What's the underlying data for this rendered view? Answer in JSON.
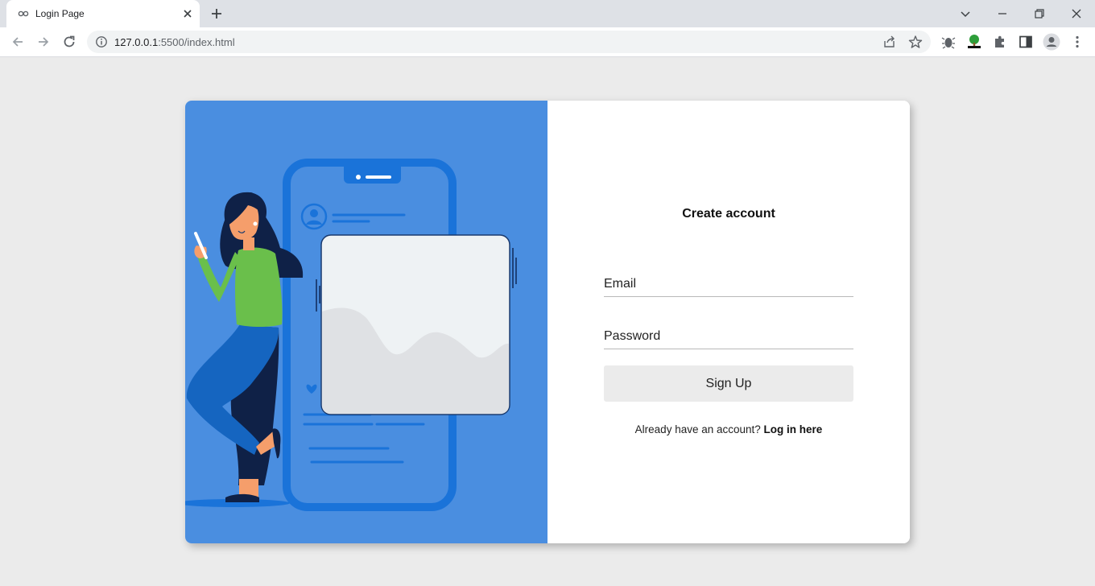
{
  "browser": {
    "tab_title": "Login Page",
    "url_host": "127.0.0.1",
    "url_rest": ":5500/index.html"
  },
  "form": {
    "title": "Create account",
    "email_placeholder": "Email",
    "password_placeholder": "Password",
    "signup_label": "Sign Up",
    "login_prompt": "Already have an account?",
    "login_link": "Log in here"
  },
  "colors": {
    "illustration_bg": "#4a8ee0",
    "phone_frame": "#1a73d9",
    "shirt": "#6abf4b",
    "pants": "#1565c0",
    "hair": "#0f2147"
  }
}
